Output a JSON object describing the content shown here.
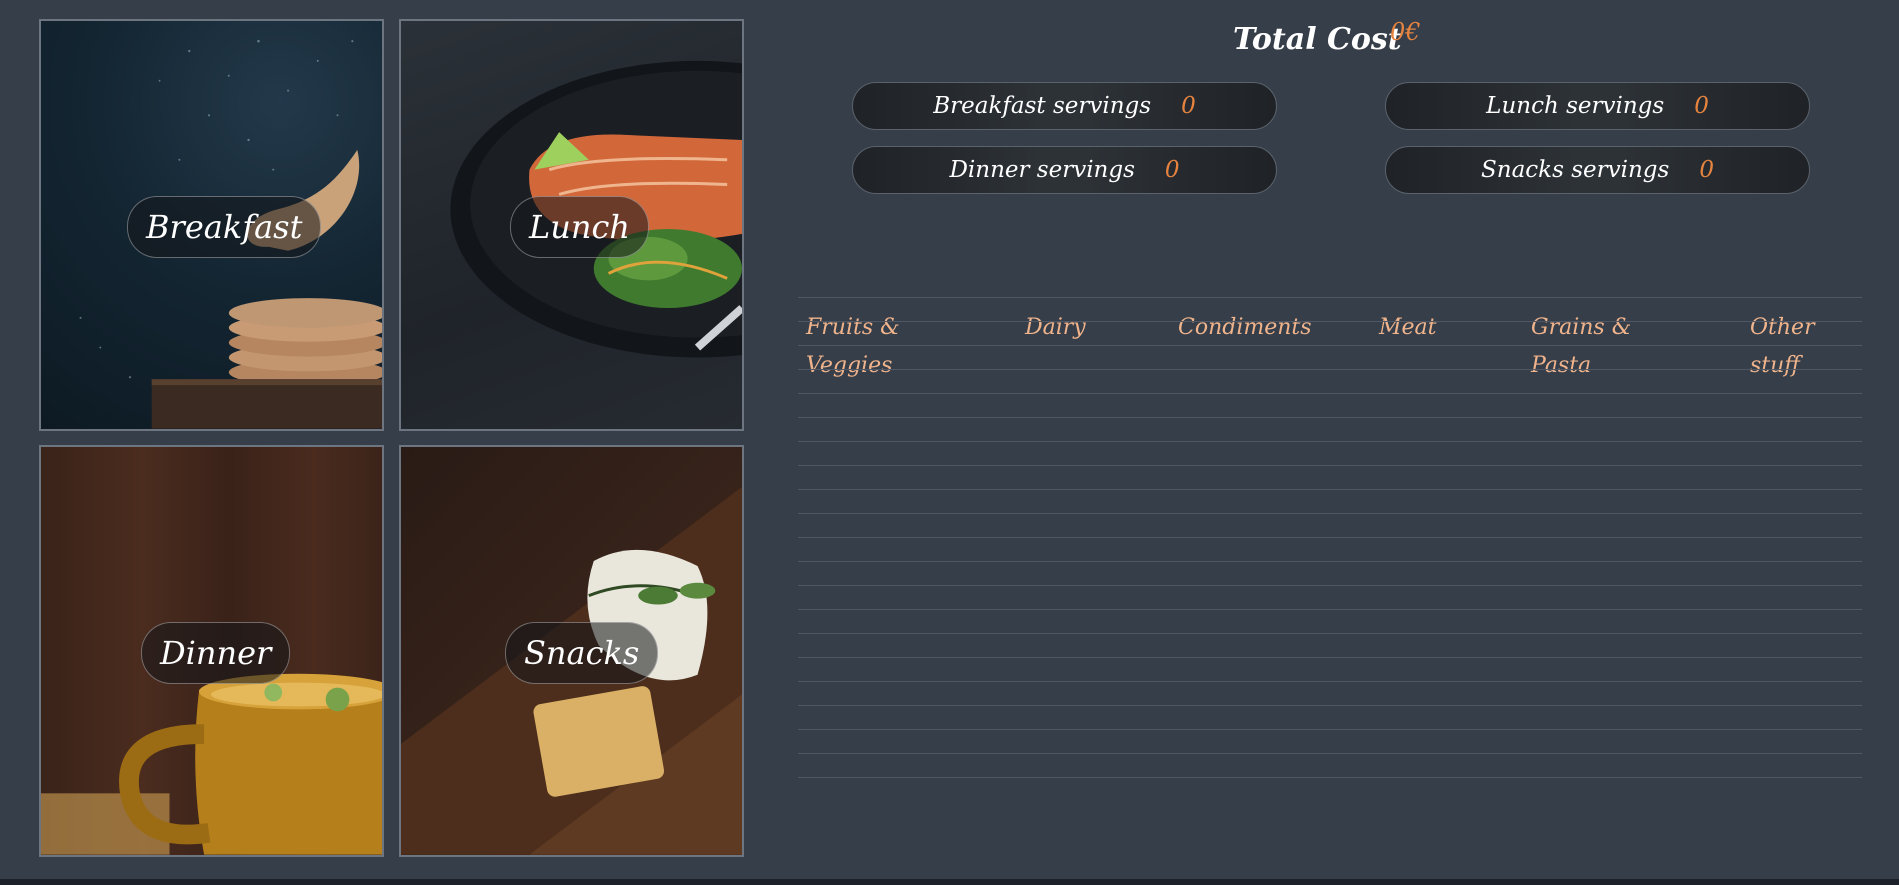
{
  "meals": {
    "breakfast": {
      "label": "Breakfast"
    },
    "lunch": {
      "label": "Lunch"
    },
    "dinner": {
      "label": "Dinner"
    },
    "snacks": {
      "label": "Snacks"
    }
  },
  "total": {
    "title": "Total Cost",
    "value": "0€"
  },
  "servings": {
    "breakfast": {
      "label": "Breakfast servings",
      "value": "0"
    },
    "lunch": {
      "label": "Lunch servings",
      "value": "0"
    },
    "dinner": {
      "label": "Dinner servings",
      "value": "0"
    },
    "snacks": {
      "label": "Snacks servings",
      "value": "0"
    }
  },
  "shopping": {
    "columns": [
      "Fruits & Veggies",
      "Dairy",
      "Condiments",
      "Meat",
      "Grains & Pasta",
      "Other stuff"
    ]
  },
  "colors": {
    "background": "#363e49",
    "accent": "#e6843f",
    "column_heading": "#f0b48c"
  }
}
